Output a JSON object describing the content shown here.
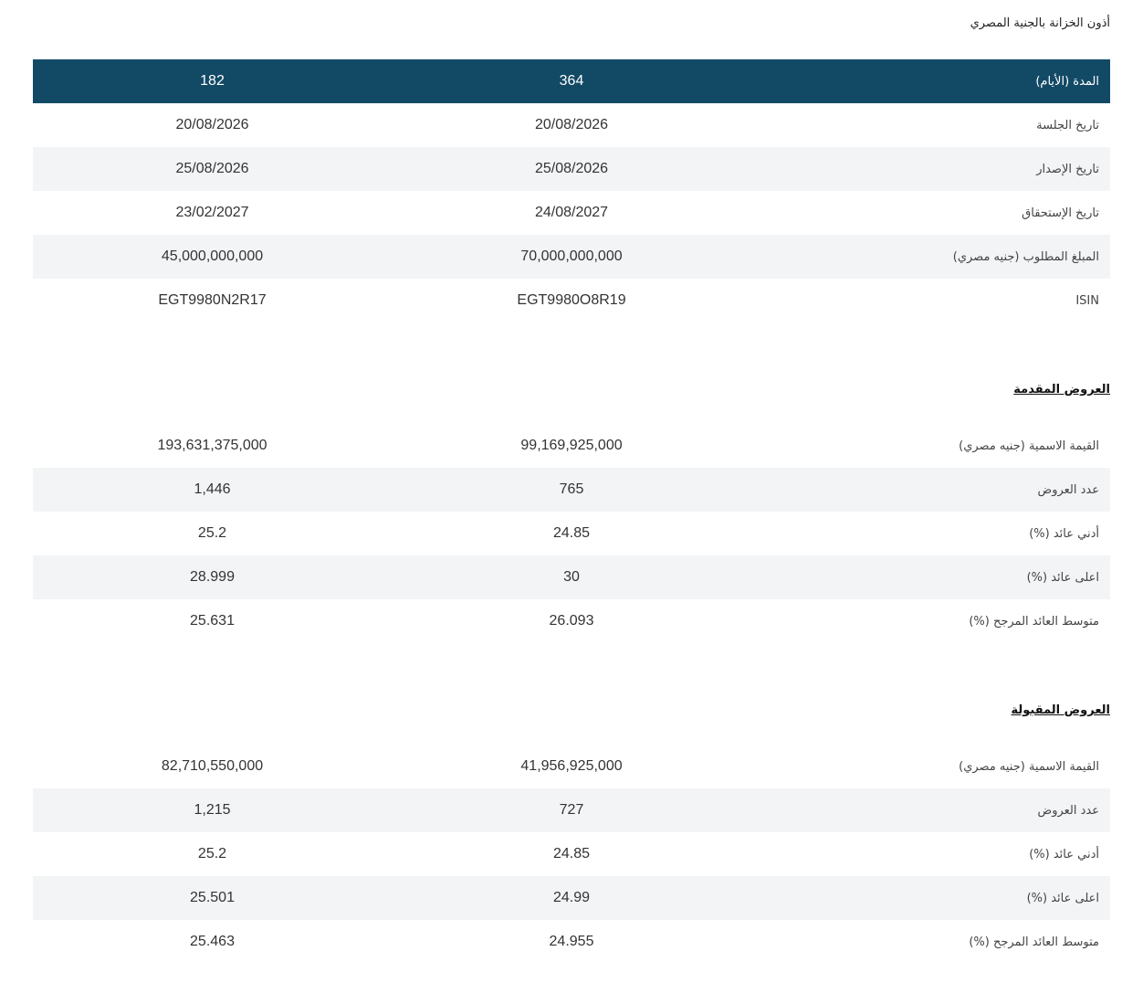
{
  "page_title": "أذون الخزانة بالجنية المصري",
  "auction_table": {
    "header": {
      "label": "المدة (الأيام)",
      "col_a": "364",
      "col_b": "182"
    },
    "rows": [
      {
        "label": "تاريخ الجلسة",
        "col_a": "20/08/2026",
        "col_b": "20/08/2026"
      },
      {
        "label": "تاريخ الإصدار",
        "col_a": "25/08/2026",
        "col_b": "25/08/2026"
      },
      {
        "label": "تاريخ الإستحقاق",
        "col_a": "24/08/2027",
        "col_b": "23/02/2027"
      },
      {
        "label": "المبلغ المطلوب (جنيه مصري)",
        "col_a": "70,000,000,000",
        "col_b": "45,000,000,000"
      },
      {
        "label": "ISIN",
        "col_a": "EGT9980O8R19",
        "col_b": "EGT9980N2R17"
      }
    ]
  },
  "bids_submitted": {
    "title": "العروض المقدمة",
    "rows": [
      {
        "label": "القيمة الاسمية (جنيه مصري)",
        "col_a": "99,169,925,000",
        "col_b": "193,631,375,000"
      },
      {
        "label": "عدد العروض",
        "col_a": "765",
        "col_b": "1,446"
      },
      {
        "label": "أدني عائد (%)",
        "col_a": "24.85",
        "col_b": "25.2"
      },
      {
        "label": "اعلى عائد (%)",
        "col_a": "30",
        "col_b": "28.999"
      },
      {
        "label": "متوسط العائد المرجح (%)",
        "col_a": "26.093",
        "col_b": "25.631"
      }
    ]
  },
  "bids_accepted": {
    "title": "العروض المقبولة",
    "rows": [
      {
        "label": "القيمة الاسمية (جنيه مصري)",
        "col_a": "41,956,925,000",
        "col_b": "82,710,550,000"
      },
      {
        "label": "عدد العروض",
        "col_a": "727",
        "col_b": "1,215"
      },
      {
        "label": "أدني عائد (%)",
        "col_a": "24.85",
        "col_b": "25.2"
      },
      {
        "label": "اعلى عائد (%)",
        "col_a": "24.99",
        "col_b": "25.501"
      },
      {
        "label": "متوسط العائد المرجح (%)",
        "col_a": "24.955",
        "col_b": "25.463"
      }
    ]
  },
  "colors": {
    "header_bg": "#124a66",
    "stripe_bg": "#f3f4f6"
  }
}
